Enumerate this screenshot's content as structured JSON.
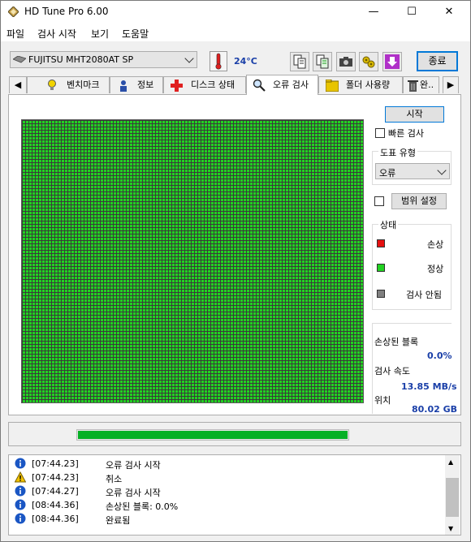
{
  "window": {
    "title": "HD Tune Pro 6.00",
    "min": "—",
    "max": "☐",
    "close": "✕"
  },
  "menu": [
    "파일",
    "검사 시작",
    "보기",
    "도움말"
  ],
  "toolbar": {
    "drive": "FUJITSU MHT2080AT  SP",
    "temperature": "24°C",
    "exit_label": "종료"
  },
  "tabs": [
    {
      "label": "",
      "icon": "chevron-left-icon"
    },
    {
      "label": "벤치마크",
      "icon": "bulb-icon"
    },
    {
      "label": "정보",
      "icon": "info-person-icon"
    },
    {
      "label": "디스크 상태",
      "icon": "red-cross-icon"
    },
    {
      "label": "오류 검사",
      "icon": "magnifier-icon"
    },
    {
      "label": "폴더 사용량",
      "icon": "folder-icon"
    },
    {
      "label": "완..",
      "icon": "trash-icon"
    }
  ],
  "scan": {
    "start_label": "시작",
    "quick_scan_label": "빠른 검사",
    "chart_type_label": "도표 유형",
    "chart_type_value": "오류",
    "range_setting_label": "범위 설정",
    "status_group_label": "상태",
    "legend": [
      {
        "label": "손상",
        "color": "#e51010"
      },
      {
        "label": "정상",
        "color": "#21d221"
      },
      {
        "label": "검사 안됨",
        "color": "#808080"
      }
    ],
    "damaged_blocks_label": "손상된 블록",
    "damaged_blocks_value": "0.0%",
    "scan_speed_label": "검사 속도",
    "scan_speed_value": "13.85 MB/s",
    "position_label": "위치",
    "position_value": "80.02 GB",
    "progress_fraction": 1.0,
    "grid_fill_color": "#21d221"
  },
  "log": [
    {
      "icon": "info-icon",
      "time": "[07:44.23]",
      "message": "오류 검사 시작"
    },
    {
      "icon": "warning-icon",
      "time": "[07:44.23]",
      "message": "취소"
    },
    {
      "icon": "info-icon",
      "time": "[07:44.27]",
      "message": "오류 검사 시작"
    },
    {
      "icon": "info-icon",
      "time": "[08:44.36]",
      "message": "손상된 블록: 0.0%"
    },
    {
      "icon": "info-icon",
      "time": "[08:44.36]",
      "message": "완료됨"
    }
  ]
}
